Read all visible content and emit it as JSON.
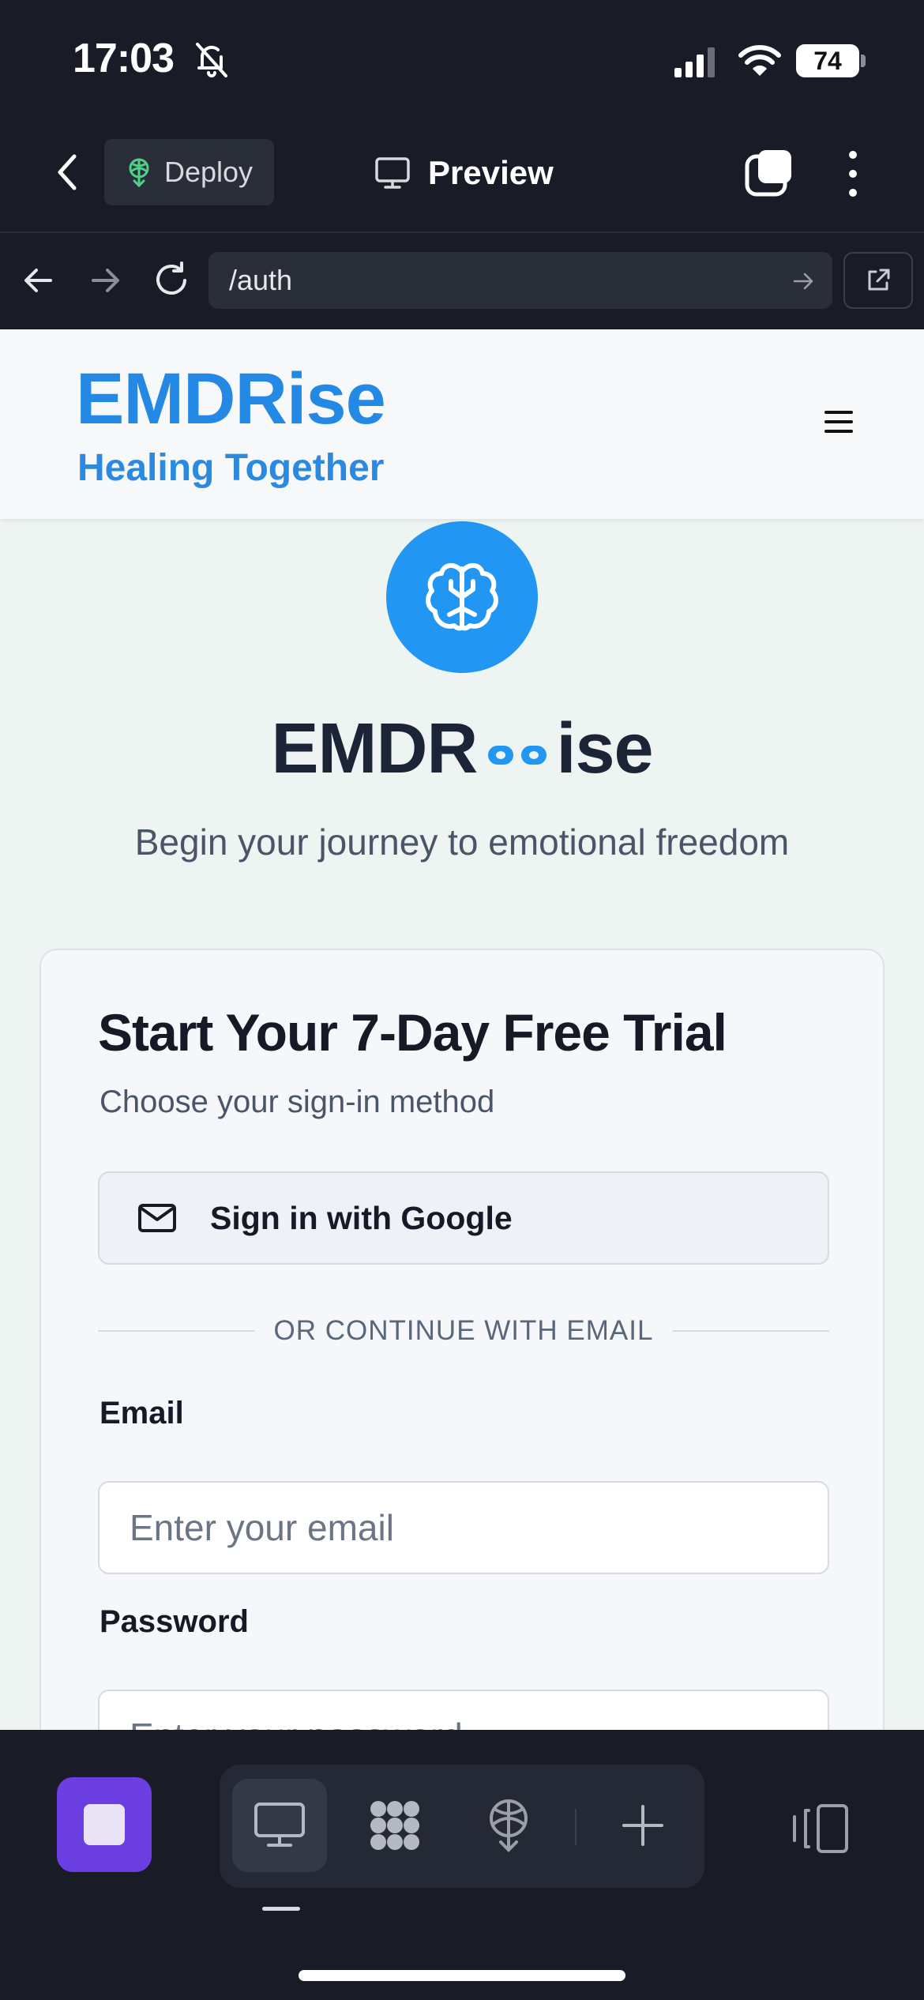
{
  "status_bar": {
    "time": "17:03",
    "battery": "74",
    "icons": [
      "bell-slash-icon",
      "cellular-signal-icon",
      "wifi-icon",
      "battery-icon"
    ]
  },
  "app_toolbar": {
    "deploy_label": "Deploy",
    "preview_label": "Preview"
  },
  "browser": {
    "url": "/auth"
  },
  "site": {
    "brand_name": "EMDRise",
    "tagline": "Healing Together",
    "hero_title_left": "EMDR",
    "hero_title_right": "ise",
    "hero_subtitle": "Begin your journey to emotional freedom"
  },
  "auth_card": {
    "title": "Start Your 7-Day Free Trial",
    "subtitle": "Choose your sign-in method",
    "google_button": "Sign in with Google",
    "divider_text": "OR CONTINUE WITH EMAIL",
    "email_label": "Email",
    "email_placeholder": "Enter your email",
    "email_value": "",
    "password_label": "Password",
    "password_placeholder": "Enter your password",
    "password_value": ""
  },
  "colors": {
    "brand_blue": "#2389e4",
    "logo_blue": "#2196f3",
    "stop_purple": "#6a3ee0",
    "chrome_dark": "#191c26",
    "page_bg": "#edf4f1"
  }
}
